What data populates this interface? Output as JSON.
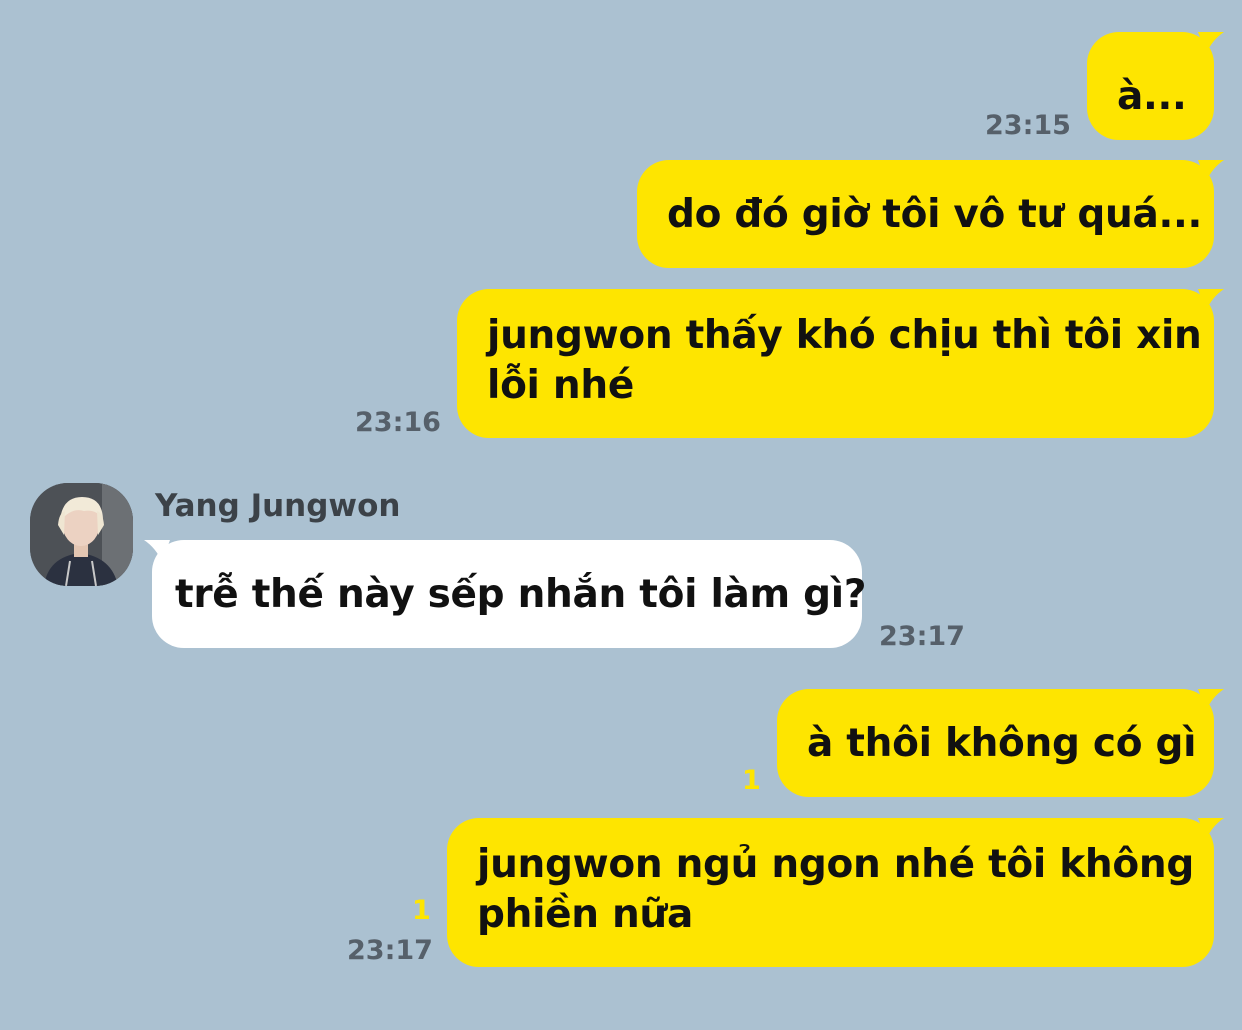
{
  "colors": {
    "background": "#abc1d1",
    "my_bubble": "#fee500",
    "their_bubble": "#ffffff",
    "timestamp": "#56606a",
    "unread": "#fee500"
  },
  "contact": {
    "name": "Yang Jungwon",
    "avatar_icon": "user-avatar"
  },
  "messages": [
    {
      "from": "me",
      "text": "à...",
      "time": "23:15",
      "unread": ""
    },
    {
      "from": "me",
      "text": "do đó giờ tôi vô tư quá...",
      "time": "",
      "unread": ""
    },
    {
      "from": "me",
      "lines": [
        "jungwon thấy khó chịu thì tôi xin",
        "lỗi nhé"
      ],
      "time": "23:16",
      "unread": ""
    },
    {
      "from": "them",
      "text": "trễ thế này sếp nhắn tôi làm gì?",
      "time": "23:17",
      "unread": ""
    },
    {
      "from": "me",
      "text": "à thôi không có gì",
      "time": "",
      "unread": "1"
    },
    {
      "from": "me",
      "lines": [
        "jungwon ngủ ngon nhé tôi không",
        "phiền nữa"
      ],
      "time": "23:17",
      "unread": "1"
    }
  ]
}
